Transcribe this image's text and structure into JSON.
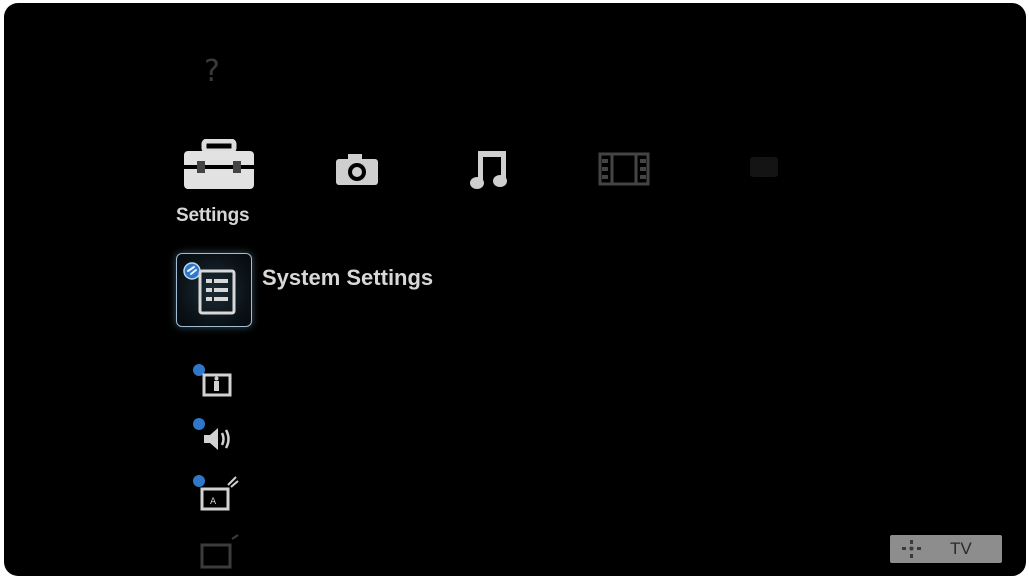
{
  "menu": {
    "help_glyph": "?",
    "categories": [
      {
        "id": "settings",
        "label": "Settings",
        "icon": "toolbox-icon",
        "selected": true
      },
      {
        "id": "photo",
        "label": "",
        "icon": "camera-icon"
      },
      {
        "id": "music",
        "label": "",
        "icon": "music-note-icon"
      },
      {
        "id": "video",
        "label": "",
        "icon": "film-strip-icon"
      }
    ],
    "selected_item": {
      "label": "System Settings",
      "icon": "system-settings-icon"
    },
    "sub_items": [
      {
        "icon": "picture-settings-icon"
      },
      {
        "icon": "sound-settings-icon"
      },
      {
        "icon": "channel-settings-icon"
      },
      {
        "icon": "display-settings-icon"
      }
    ]
  },
  "footer": {
    "tv_label": "TV",
    "dpad_icon": "dpad-icon"
  },
  "colors": {
    "background": "#000000",
    "selection_border": "#9ebfd7",
    "badge_blue": "#2f78c9"
  }
}
